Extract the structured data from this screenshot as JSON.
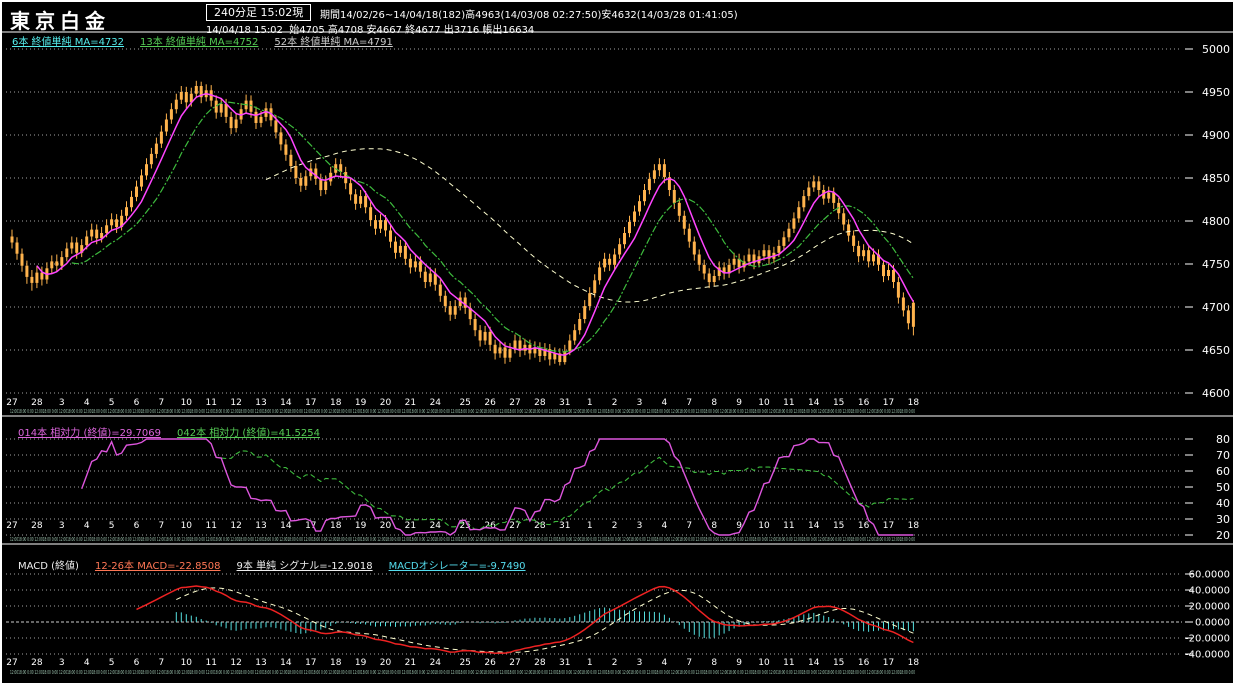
{
  "header": {
    "title": "東京白金",
    "timeframe_box": "240分足 15:02現",
    "period_line": "期間14/02/26~14/04/18(182)高4963(14/03/08 02:27:50)安4632(14/03/28 01:41:05)",
    "ohlc_line": "14/04/18 15:02  始4705 高4708 安4667 終4677 出3716 帳出16634"
  },
  "legends": {
    "ma": [
      {
        "label": "6本 終値単純 MA=4732",
        "color": "#55eeee"
      },
      {
        "label": "13本 終値単純 MA=4752",
        "color": "#55cc55"
      },
      {
        "label": "52本 終値単純 MA=4791",
        "color": "#cccccc"
      }
    ],
    "rsi": [
      {
        "label": "014本 相対力 (終値)=29.7069",
        "color": "#dd66dd"
      },
      {
        "label": "042本 相対力 (終値)=41.5254",
        "color": "#55cc55"
      }
    ],
    "macd": [
      {
        "label": "MACD (終値)",
        "color": "#eeeeee",
        "underline": false
      },
      {
        "label": "12-26本 MACD=-22.8508",
        "color": "#ff7755"
      },
      {
        "label": "9本 単純 シグナル=-12.9018",
        "color": "#eeeeee"
      },
      {
        "label": "MACDオシレーター=-9.7490",
        "color": "#55ddee"
      }
    ]
  },
  "chart_data": {
    "type": "candlestick",
    "title": "東京白金 240分足",
    "bar_interval_minutes": 240,
    "bar_count": 182,
    "period": "14/02/26~14/04/18",
    "period_high": 4963,
    "period_low": 4632,
    "last_bar": {
      "open": 4705,
      "high": 4708,
      "low": 4667,
      "close": 4677,
      "volume": 3716,
      "open_interest": 16634
    },
    "price_axis": {
      "min": 4600,
      "max": 5000,
      "step": 50,
      "labels": [
        "5000",
        "4950",
        "4900",
        "4850",
        "4800",
        "4750",
        "4700",
        "4650",
        "4600"
      ]
    },
    "rsi_axis": {
      "min": 20,
      "max": 80,
      "step": 10,
      "labels": [
        "80",
        "70",
        "60",
        "50",
        "40",
        "30",
        "20"
      ]
    },
    "macd_axis": {
      "min": -40,
      "max": 60,
      "step": 20,
      "labels": [
        "60.0000",
        "40.0000",
        "20.0000",
        "0.0000",
        "-20.0000",
        "-40.0000"
      ]
    },
    "ma_periods": [
      6,
      13,
      52
    ],
    "ma_values": [
      4732,
      4752,
      4791
    ],
    "rsi_periods": [
      14,
      42
    ],
    "rsi_values": [
      29.7069,
      41.5254
    ],
    "macd_params": {
      "fast": 12,
      "slow": 26,
      "signal": 9
    },
    "macd_values": {
      "macd": -22.8508,
      "signal": -12.9018,
      "oscillator": -9.749
    },
    "date_labels": [
      "27",
      "28",
      "3",
      "4",
      "5",
      "6",
      "7",
      "10",
      "11",
      "12",
      "13",
      "14",
      "17",
      "18",
      "19",
      "20",
      "21",
      "24",
      "25",
      "26",
      "27",
      "28",
      "31",
      "1",
      "2",
      "3",
      "4",
      "7",
      "8",
      "9",
      "10",
      "11",
      "14",
      "15",
      "16",
      "17",
      "18"
    ],
    "time_row_unit": "12:0018:00 0:00 ",
    "colors": {
      "candle": "#ffb34d",
      "ma6": "#ff44ff",
      "ma13": "#3dbb3d",
      "ma52": "#ffffd0",
      "rsi14": "#dd55dd",
      "rsi42": "#3dbb3d",
      "macd": "#ee2222",
      "signal": "#ffffd0",
      "hist": "#55e0e0",
      "grid": "#cccccc",
      "axis_text": "#ffffff",
      "time_text": "#9fc7b2"
    },
    "candles": [
      [
        4782,
        4790,
        4768,
        4775
      ],
      [
        4775,
        4781,
        4755,
        4762
      ],
      [
        4762,
        4768,
        4741,
        4748
      ],
      [
        4748,
        4754,
        4727,
        4735
      ],
      [
        4735,
        4743,
        4719,
        4728
      ],
      [
        4728,
        4748,
        4722,
        4740
      ],
      [
        4740,
        4747,
        4725,
        4732
      ],
      [
        4732,
        4752,
        4727,
        4745
      ],
      [
        4745,
        4760,
        4739,
        4753
      ],
      [
        4753,
        4761,
        4741,
        4748
      ],
      [
        4748,
        4765,
        4743,
        4758
      ],
      [
        4758,
        4775,
        4753,
        4768
      ],
      [
        4768,
        4782,
        4762,
        4775
      ],
      [
        4775,
        4781,
        4756,
        4763
      ],
      [
        4763,
        4779,
        4758,
        4772
      ],
      [
        4772,
        4789,
        4767,
        4782
      ],
      [
        4782,
        4797,
        4777,
        4790
      ],
      [
        4790,
        4796,
        4773,
        4780
      ],
      [
        4780,
        4793,
        4775,
        4786
      ],
      [
        4786,
        4802,
        4781,
        4795
      ],
      [
        4795,
        4809,
        4790,
        4802
      ],
      [
        4802,
        4808,
        4786,
        4793
      ],
      [
        4793,
        4813,
        4789,
        4806
      ],
      [
        4806,
        4823,
        4801,
        4816
      ],
      [
        4816,
        4835,
        4811,
        4828
      ],
      [
        4828,
        4847,
        4823,
        4840
      ],
      [
        4840,
        4860,
        4835,
        4853
      ],
      [
        4853,
        4873,
        4848,
        4866
      ],
      [
        4866,
        4885,
        4861,
        4878
      ],
      [
        4878,
        4897,
        4873,
        4890
      ],
      [
        4890,
        4911,
        4885,
        4904
      ],
      [
        4904,
        4925,
        4899,
        4918
      ],
      [
        4918,
        4937,
        4913,
        4930
      ],
      [
        4930,
        4948,
        4925,
        4941
      ],
      [
        4941,
        4957,
        4936,
        4950
      ],
      [
        4950,
        4956,
        4931,
        4938
      ],
      [
        4938,
        4955,
        4933,
        4948
      ],
      [
        4948,
        4963,
        4943,
        4957
      ],
      [
        4957,
        4962,
        4937,
        4944
      ],
      [
        4944,
        4959,
        4939,
        4952
      ],
      [
        4952,
        4958,
        4933,
        4940
      ],
      [
        4940,
        4946,
        4919,
        4926
      ],
      [
        4926,
        4943,
        4921,
        4936
      ],
      [
        4936,
        4942,
        4914,
        4921
      ],
      [
        4921,
        4927,
        4901,
        4908
      ],
      [
        4908,
        4925,
        4903,
        4918
      ],
      [
        4918,
        4937,
        4913,
        4930
      ],
      [
        4930,
        4947,
        4925,
        4940
      ],
      [
        4940,
        4946,
        4920,
        4927
      ],
      [
        4927,
        4933,
        4907,
        4914
      ],
      [
        4914,
        4928,
        4909,
        4921
      ],
      [
        4921,
        4938,
        4916,
        4931
      ],
      [
        4931,
        4937,
        4910,
        4917
      ],
      [
        4917,
        4923,
        4896,
        4903
      ],
      [
        4903,
        4909,
        4882,
        4889
      ],
      [
        4889,
        4895,
        4870,
        4877
      ],
      [
        4877,
        4883,
        4857,
        4864
      ],
      [
        4864,
        4870,
        4843,
        4850
      ],
      [
        4850,
        4856,
        4834,
        4841
      ],
      [
        4841,
        4859,
        4836,
        4852
      ],
      [
        4852,
        4868,
        4847,
        4861
      ],
      [
        4861,
        4867,
        4842,
        4849
      ],
      [
        4849,
        4855,
        4829,
        4836
      ],
      [
        4836,
        4853,
        4831,
        4846
      ],
      [
        4846,
        4863,
        4841,
        4856
      ],
      [
        4856,
        4873,
        4851,
        4866
      ],
      [
        4866,
        4872,
        4850,
        4857
      ],
      [
        4857,
        4863,
        4837,
        4844
      ],
      [
        4844,
        4850,
        4824,
        4831
      ],
      [
        4831,
        4837,
        4813,
        4820
      ],
      [
        4820,
        4836,
        4815,
        4829
      ],
      [
        4829,
        4835,
        4809,
        4816
      ],
      [
        4816,
        4822,
        4794,
        4801
      ],
      [
        4801,
        4807,
        4784,
        4791
      ],
      [
        4791,
        4808,
        4786,
        4801
      ],
      [
        4801,
        4807,
        4782,
        4789
      ],
      [
        4789,
        4795,
        4769,
        4776
      ],
      [
        4776,
        4782,
        4756,
        4763
      ],
      [
        4763,
        4778,
        4758,
        4771
      ],
      [
        4771,
        4777,
        4749,
        4756
      ],
      [
        4756,
        4762,
        4739,
        4746
      ],
      [
        4746,
        4760,
        4741,
        4753
      ],
      [
        4753,
        4759,
        4734,
        4741
      ],
      [
        4741,
        4747,
        4722,
        4729
      ],
      [
        4729,
        4746,
        4724,
        4739
      ],
      [
        4739,
        4745,
        4719,
        4726
      ],
      [
        4726,
        4732,
        4706,
        4713
      ],
      [
        4713,
        4719,
        4694,
        4701
      ],
      [
        4701,
        4707,
        4684,
        4691
      ],
      [
        4691,
        4708,
        4686,
        4701
      ],
      [
        4701,
        4718,
        4696,
        4711
      ],
      [
        4711,
        4717,
        4692,
        4699
      ],
      [
        4699,
        4705,
        4679,
        4686
      ],
      [
        4686,
        4692,
        4666,
        4673
      ],
      [
        4673,
        4679,
        4654,
        4661
      ],
      [
        4661,
        4678,
        4656,
        4671
      ],
      [
        4671,
        4677,
        4649,
        4656
      ],
      [
        4656,
        4662,
        4639,
        4646
      ],
      [
        4646,
        4660,
        4641,
        4653
      ],
      [
        4653,
        4659,
        4634,
        4641
      ],
      [
        4641,
        4658,
        4636,
        4651
      ],
      [
        4651,
        4668,
        4646,
        4661
      ],
      [
        4661,
        4667,
        4642,
        4649
      ],
      [
        4649,
        4663,
        4644,
        4656
      ],
      [
        4656,
        4662,
        4639,
        4646
      ],
      [
        4646,
        4660,
        4641,
        4653
      ],
      [
        4653,
        4659,
        4636,
        4643
      ],
      [
        4643,
        4658,
        4638,
        4651
      ],
      [
        4651,
        4657,
        4632,
        4639
      ],
      [
        4639,
        4653,
        4634,
        4646
      ],
      [
        4646,
        4652,
        4632,
        4636
      ],
      [
        4636,
        4656,
        4633,
        4649
      ],
      [
        4649,
        4668,
        4644,
        4661
      ],
      [
        4661,
        4680,
        4656,
        4673
      ],
      [
        4673,
        4693,
        4668,
        4686
      ],
      [
        4686,
        4708,
        4681,
        4701
      ],
      [
        4701,
        4723,
        4696,
        4716
      ],
      [
        4716,
        4738,
        4711,
        4731
      ],
      [
        4731,
        4753,
        4726,
        4746
      ],
      [
        4746,
        4763,
        4741,
        4756
      ],
      [
        4756,
        4762,
        4742,
        4749
      ],
      [
        4749,
        4768,
        4744,
        4761
      ],
      [
        4761,
        4780,
        4756,
        4773
      ],
      [
        4773,
        4793,
        4768,
        4786
      ],
      [
        4786,
        4806,
        4781,
        4799
      ],
      [
        4799,
        4818,
        4794,
        4811
      ],
      [
        4811,
        4830,
        4806,
        4823
      ],
      [
        4823,
        4843,
        4818,
        4836
      ],
      [
        4836,
        4856,
        4831,
        4849
      ],
      [
        4849,
        4866,
        4844,
        4859
      ],
      [
        4859,
        4873,
        4852,
        4866
      ],
      [
        4866,
        4872,
        4844,
        4851
      ],
      [
        4851,
        4857,
        4829,
        4836
      ],
      [
        4836,
        4842,
        4814,
        4821
      ],
      [
        4821,
        4827,
        4799,
        4806
      ],
      [
        4806,
        4812,
        4784,
        4791
      ],
      [
        4791,
        4797,
        4769,
        4776
      ],
      [
        4776,
        4782,
        4754,
        4761
      ],
      [
        4761,
        4767,
        4742,
        4749
      ],
      [
        4749,
        4755,
        4732,
        4739
      ],
      [
        4739,
        4745,
        4722,
        4729
      ],
      [
        4729,
        4743,
        4724,
        4736
      ],
      [
        4736,
        4753,
        4731,
        4746
      ],
      [
        4746,
        4752,
        4732,
        4739
      ],
      [
        4739,
        4756,
        4734,
        4749
      ],
      [
        4749,
        4763,
        4744,
        4756
      ],
      [
        4756,
        4762,
        4739,
        4746
      ],
      [
        4746,
        4760,
        4741,
        4753
      ],
      [
        4753,
        4768,
        4748,
        4761
      ],
      [
        4761,
        4767,
        4744,
        4751
      ],
      [
        4751,
        4766,
        4746,
        4759
      ],
      [
        4759,
        4773,
        4754,
        4766
      ],
      [
        4766,
        4772,
        4749,
        4756
      ],
      [
        4756,
        4770,
        4751,
        4763
      ],
      [
        4763,
        4778,
        4758,
        4771
      ],
      [
        4771,
        4788,
        4766,
        4781
      ],
      [
        4781,
        4798,
        4776,
        4791
      ],
      [
        4791,
        4810,
        4786,
        4803
      ],
      [
        4803,
        4823,
        4798,
        4816
      ],
      [
        4816,
        4836,
        4811,
        4829
      ],
      [
        4829,
        4846,
        4824,
        4839
      ],
      [
        4839,
        4853,
        4834,
        4846
      ],
      [
        4846,
        4852,
        4829,
        4836
      ],
      [
        4836,
        4842,
        4819,
        4826
      ],
      [
        4826,
        4840,
        4821,
        4833
      ],
      [
        4833,
        4839,
        4814,
        4821
      ],
      [
        4821,
        4827,
        4802,
        4809
      ],
      [
        4809,
        4815,
        4789,
        4796
      ],
      [
        4796,
        4802,
        4776,
        4783
      ],
      [
        4783,
        4789,
        4764,
        4771
      ],
      [
        4771,
        4777,
        4752,
        4759
      ],
      [
        4759,
        4773,
        4754,
        4766
      ],
      [
        4766,
        4772,
        4746,
        4753
      ],
      [
        4753,
        4768,
        4748,
        4761
      ],
      [
        4761,
        4767,
        4742,
        4749
      ],
      [
        4749,
        4755,
        4729,
        4736
      ],
      [
        4736,
        4750,
        4731,
        4743
      ],
      [
        4743,
        4749,
        4722,
        4729
      ],
      [
        4729,
        4735,
        4704,
        4711
      ],
      [
        4711,
        4717,
        4689,
        4696
      ],
      [
        4696,
        4702,
        4674,
        4681
      ],
      [
        4705,
        4708,
        4667,
        4677
      ]
    ]
  }
}
